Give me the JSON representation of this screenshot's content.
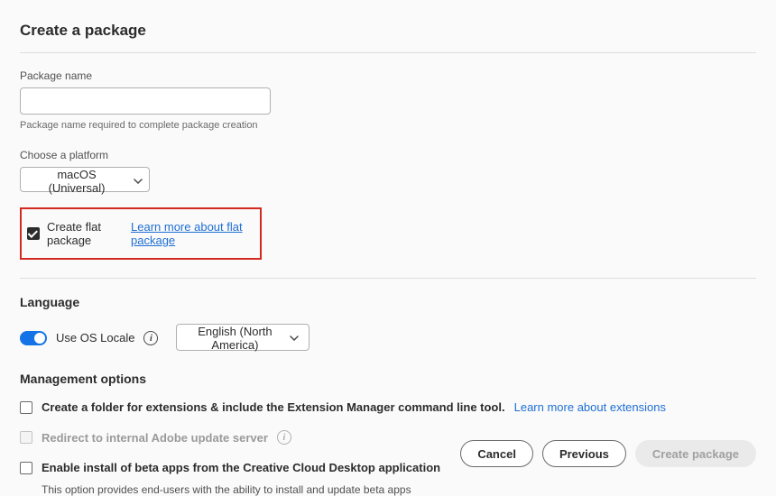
{
  "title": "Create a package",
  "packageName": {
    "label": "Package name",
    "value": "",
    "help": "Package name required to complete package creation"
  },
  "platform": {
    "label": "Choose a platform",
    "selected": "macOS (Universal)"
  },
  "flatPackage": {
    "checked": true,
    "label": "Create flat package",
    "link": "Learn more about flat package"
  },
  "language": {
    "title": "Language",
    "toggleLabel": "Use OS Locale",
    "toggleOn": true,
    "selected": "English (North America)"
  },
  "management": {
    "title": "Management options",
    "ext": {
      "checked": false,
      "label": "Create a folder for extensions & include the Extension Manager command line tool.",
      "link": "Learn more about extensions"
    },
    "redirect": {
      "checked": false,
      "disabled": true,
      "label": "Redirect to internal Adobe update server"
    },
    "beta": {
      "checked": false,
      "label": "Enable install of beta apps from the Creative Cloud Desktop application",
      "help": "This option provides end-users with the ability to install and update beta apps"
    }
  },
  "buttons": {
    "cancel": "Cancel",
    "previous": "Previous",
    "create": "Create package"
  }
}
